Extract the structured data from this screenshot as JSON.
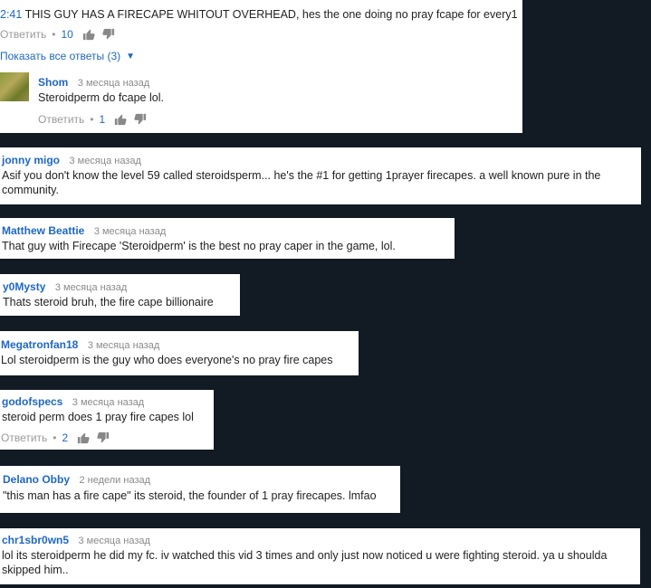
{
  "thread_top": {
    "timestamp": "2:41",
    "text": "THIS GUY HAS A FIRECAPE WHITOUT OVERHEAD, hes the one doing no pray fcape for every1",
    "reply_label": "Ответить",
    "likes": "10",
    "show_replies": "Показать все ответы (3)"
  },
  "reply_shom": {
    "author": "Shom",
    "time": "3 месяца назад",
    "text": "Steroidperm do fcape lol.",
    "reply_label": "Ответить",
    "likes": "1"
  },
  "comments": [
    {
      "author": "jonny migo",
      "time": "3 месяца назад",
      "text": "Asif you don't know the level 59 called steroidsperm... he's the #1 for getting 1prayer firecapes. a well known pure in the community."
    },
    {
      "author": "Matthew Beattie",
      "time": "3 месяца назад",
      "text": "That guy with Firecape 'Steroidperm' is the best no pray caper in the game, lol."
    },
    {
      "author": "y0Mysty",
      "time": "3 месяца назад",
      "text": "Thats steroid bruh, the fire cape billionaire"
    },
    {
      "author": "Megatronfan18",
      "time": "3 месяца назад",
      "text": "Lol steroidperm is the guy who does everyone's no pray fire capes"
    },
    {
      "author": "godofspecs",
      "time": "3 месяца назад",
      "text": "steroid perm does 1 pray fire capes lol",
      "reply_label": "Ответить",
      "likes": "2"
    },
    {
      "author": "Delano Obby",
      "time": "2 недели назад",
      "text": "\"this man has a fire cape\" its steroid, the founder of 1 pray firecapes. lmfao"
    },
    {
      "author": "chr1sbr0wn5",
      "time": "3 месяца назад",
      "text": "lol its steroidperm he did my fc. iv watched this vid 3 times and only just now noticed u were fighting steroid. ya u shoulda skipped him.."
    }
  ]
}
